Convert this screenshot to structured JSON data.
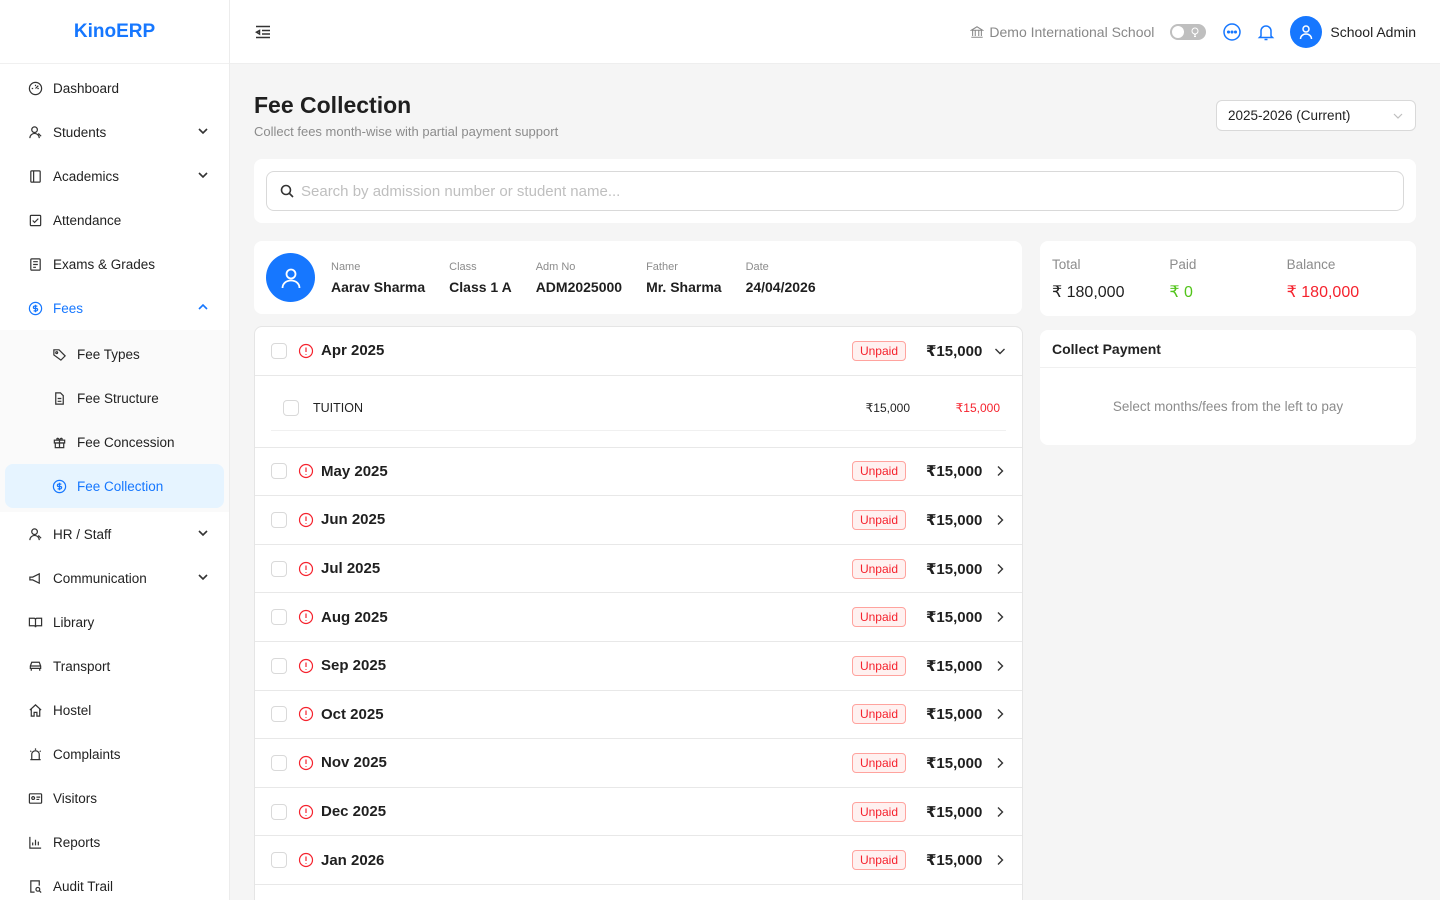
{
  "brand": "KinoERP",
  "sidebar": {
    "items": [
      {
        "label": "Dashboard"
      },
      {
        "label": "Students"
      },
      {
        "label": "Academics"
      },
      {
        "label": "Attendance"
      },
      {
        "label": "Exams & Grades"
      },
      {
        "label": "Fees"
      },
      {
        "label": "HR / Staff"
      },
      {
        "label": "Communication"
      },
      {
        "label": "Library"
      },
      {
        "label": "Transport"
      },
      {
        "label": "Hostel"
      },
      {
        "label": "Complaints"
      },
      {
        "label": "Visitors"
      },
      {
        "label": "Reports"
      },
      {
        "label": "Audit Trail"
      }
    ],
    "fees_sub": [
      {
        "label": "Fee Types"
      },
      {
        "label": "Fee Structure"
      },
      {
        "label": "Fee Concession"
      },
      {
        "label": "Fee Collection"
      }
    ]
  },
  "header": {
    "school": "Demo International School",
    "user": "School Admin"
  },
  "page": {
    "title": "Fee Collection",
    "subtitle": "Collect fees month-wise with partial payment support",
    "year": "2025-2026 (Current)",
    "search_placeholder": "Search by admission number or student name..."
  },
  "student": {
    "name_label": "Name",
    "name": "Aarav Sharma",
    "class_label": "Class",
    "class": "Class 1 A",
    "adm_label": "Adm No",
    "adm": "ADM2025000",
    "father_label": "Father",
    "father": "Mr. Sharma",
    "date_label": "Date",
    "date": "24/04/2026"
  },
  "months": [
    {
      "name": "Apr 2025",
      "status": "Unpaid",
      "amount": "₹15,000",
      "expanded": true
    },
    {
      "name": "May 2025",
      "status": "Unpaid",
      "amount": "₹15,000"
    },
    {
      "name": "Jun 2025",
      "status": "Unpaid",
      "amount": "₹15,000"
    },
    {
      "name": "Jul 2025",
      "status": "Unpaid",
      "amount": "₹15,000"
    },
    {
      "name": "Aug 2025",
      "status": "Unpaid",
      "amount": "₹15,000"
    },
    {
      "name": "Sep 2025",
      "status": "Unpaid",
      "amount": "₹15,000"
    },
    {
      "name": "Oct 2025",
      "status": "Unpaid",
      "amount": "₹15,000"
    },
    {
      "name": "Nov 2025",
      "status": "Unpaid",
      "amount": "₹15,000"
    },
    {
      "name": "Dec 2025",
      "status": "Unpaid",
      "amount": "₹15,000"
    },
    {
      "name": "Jan 2026",
      "status": "Unpaid",
      "amount": "₹15,000"
    }
  ],
  "expanded_fee": {
    "name": "TUITION",
    "amount": "₹15,000",
    "due": "₹15,000"
  },
  "summary": {
    "total_label": "Total",
    "total": "₹ 180,000",
    "paid_label": "Paid",
    "paid": "₹ 0",
    "balance_label": "Balance",
    "balance": "₹ 180,000"
  },
  "collect": {
    "title": "Collect Payment",
    "message": "Select months/fees from the left to pay"
  },
  "colors": {
    "accent": "#1677ff",
    "danger": "#f5222d",
    "success": "#52c41a"
  }
}
